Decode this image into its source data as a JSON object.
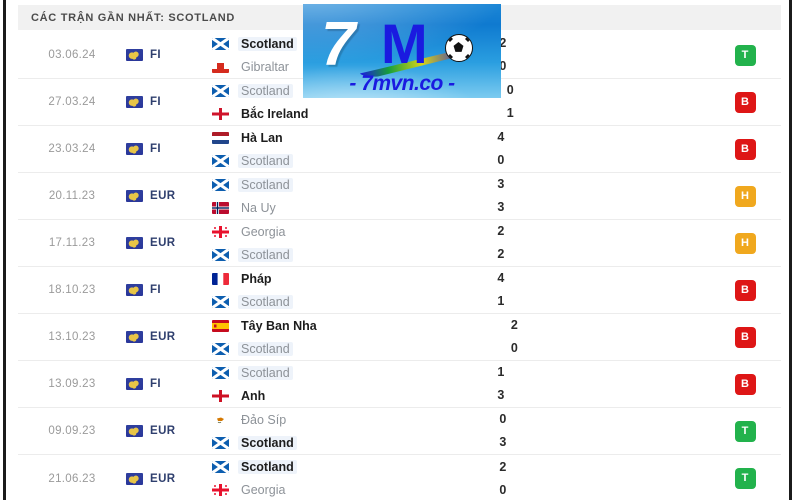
{
  "header": {
    "title": "CÁC TRẬN GẦN NHẤT: SCOTLAND"
  },
  "watermark": {
    "brand_number": "7",
    "brand_letter": "M",
    "url": "- 7mvn.co -",
    "ball_icon": "soccer-ball-icon",
    "bg_color": "#0f7ad0",
    "letter_color": "#1a1ae0"
  },
  "colors": {
    "badge_win": "#22b24c",
    "badge_loss": "#de1616",
    "badge_draw": "#f0a81e",
    "header_bg": "#f1f1f1",
    "row_divider": "#ececec",
    "team_dim": "#8d9298",
    "team_bold": "#1d1d1d",
    "comp_label": "#2f3f6e",
    "date_text": "#9a9a9a"
  },
  "legend": {
    "win": "T",
    "loss": "B",
    "draw": "H"
  },
  "matches": [
    {
      "date": "03.06.24",
      "competition": "FI",
      "home": {
        "team": "Scotland",
        "flag": "scotland",
        "score": "2",
        "bold": true,
        "highlight": true
      },
      "away": {
        "team": "Gibraltar",
        "flag": "gibraltar",
        "score": "0",
        "bold": false,
        "highlight": false
      },
      "result": "T",
      "result_color": "#22b24c"
    },
    {
      "date": "27.03.24",
      "competition": "FI",
      "home": {
        "team": "Scotland",
        "flag": "scotland",
        "score": "0",
        "bold": false,
        "highlight": true
      },
      "away": {
        "team": "Bắc Ireland",
        "flag": "northern-ireland",
        "score": "1",
        "bold": true,
        "highlight": false
      },
      "result": "B",
      "result_color": "#de1616"
    },
    {
      "date": "23.03.24",
      "competition": "FI",
      "home": {
        "team": "Hà Lan",
        "flag": "netherlands",
        "score": "4",
        "bold": true,
        "highlight": false
      },
      "away": {
        "team": "Scotland",
        "flag": "scotland",
        "score": "0",
        "bold": false,
        "highlight": true
      },
      "result": "B",
      "result_color": "#de1616"
    },
    {
      "date": "20.11.23",
      "competition": "EUR",
      "home": {
        "team": "Scotland",
        "flag": "scotland",
        "score": "3",
        "bold": false,
        "highlight": true
      },
      "away": {
        "team": "Na Uy",
        "flag": "norway",
        "score": "3",
        "bold": false,
        "highlight": false
      },
      "result": "H",
      "result_color": "#f0a81e"
    },
    {
      "date": "17.11.23",
      "competition": "EUR",
      "home": {
        "team": "Georgia",
        "flag": "georgia",
        "score": "2",
        "bold": false,
        "highlight": false
      },
      "away": {
        "team": "Scotland",
        "flag": "scotland",
        "score": "2",
        "bold": false,
        "highlight": true
      },
      "result": "H",
      "result_color": "#f0a81e"
    },
    {
      "date": "18.10.23",
      "competition": "FI",
      "home": {
        "team": "Pháp",
        "flag": "france",
        "score": "4",
        "bold": true,
        "highlight": false
      },
      "away": {
        "team": "Scotland",
        "flag": "scotland",
        "score": "1",
        "bold": false,
        "highlight": true
      },
      "result": "B",
      "result_color": "#de1616"
    },
    {
      "date": "13.10.23",
      "competition": "EUR",
      "home": {
        "team": "Tây Ban Nha",
        "flag": "spain",
        "score": "2",
        "bold": true,
        "highlight": false
      },
      "away": {
        "team": "Scotland",
        "flag": "scotland",
        "score": "0",
        "bold": false,
        "highlight": true
      },
      "result": "B",
      "result_color": "#de1616"
    },
    {
      "date": "13.09.23",
      "competition": "FI",
      "home": {
        "team": "Scotland",
        "flag": "scotland",
        "score": "1",
        "bold": false,
        "highlight": true
      },
      "away": {
        "team": "Anh",
        "flag": "england",
        "score": "3",
        "bold": true,
        "highlight": false
      },
      "result": "B",
      "result_color": "#de1616"
    },
    {
      "date": "09.09.23",
      "competition": "EUR",
      "home": {
        "team": "Đảo Síp",
        "flag": "cyprus",
        "score": "0",
        "bold": false,
        "highlight": false
      },
      "away": {
        "team": "Scotland",
        "flag": "scotland",
        "score": "3",
        "bold": true,
        "highlight": true
      },
      "result": "T",
      "result_color": "#22b24c"
    },
    {
      "date": "21.06.23",
      "competition": "EUR",
      "home": {
        "team": "Scotland",
        "flag": "scotland",
        "score": "2",
        "bold": true,
        "highlight": true
      },
      "away": {
        "team": "Georgia",
        "flag": "georgia",
        "score": "0",
        "bold": false,
        "highlight": false
      },
      "result": "T",
      "result_color": "#22b24c"
    }
  ]
}
